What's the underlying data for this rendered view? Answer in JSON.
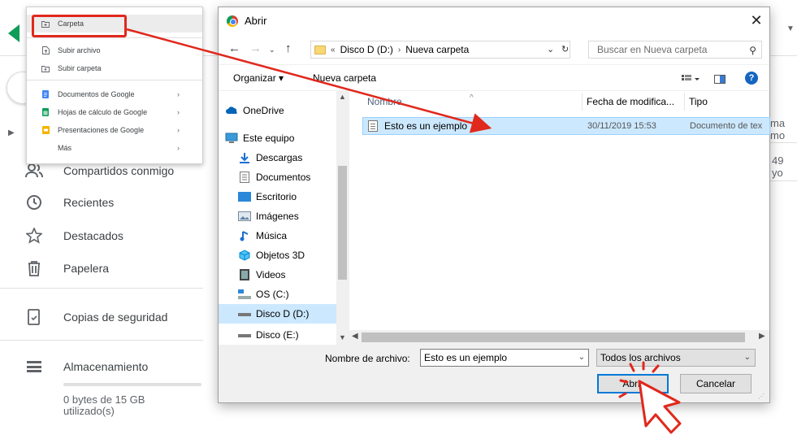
{
  "drive": {
    "nav": {
      "shared": "Compartidos conmigo",
      "recent": "Recientes",
      "starred": "Destacados",
      "trash": "Papelera",
      "backups": "Copias de seguridad",
      "storage": "Almacenamiento"
    },
    "storage_text": "0 bytes de 15 GB utilizado(s)",
    "right_fragment_1": "ma mo",
    "right_fragment_2": "49 yo"
  },
  "new_menu": {
    "items": [
      {
        "label": "Carpeta",
        "icon": "folder-plus-icon"
      },
      {
        "label": "Subir archivo",
        "icon": "file-upload-icon"
      },
      {
        "label": "Subir carpeta",
        "icon": "folder-upload-icon"
      },
      {
        "label": "Documentos de Google",
        "icon": "google-docs-icon",
        "color": "#4285f4"
      },
      {
        "label": "Hojas de cálculo de Google",
        "icon": "google-sheets-icon",
        "color": "#0f9d58"
      },
      {
        "label": "Presentaciones de Google",
        "icon": "google-slides-icon",
        "color": "#f4b400"
      },
      {
        "label": "Más",
        "icon": ""
      }
    ]
  },
  "dialog": {
    "title": "Abrir",
    "close": "✕",
    "address": {
      "prefix": "«",
      "segments": [
        "Disco D (D:)",
        "Nueva carpeta"
      ]
    },
    "search_placeholder": "Buscar en Nueva carpeta",
    "toolbar": {
      "organize": "Organizar ▾",
      "new_folder": "Nueva carpeta"
    },
    "nav_pane": [
      {
        "label": "OneDrive",
        "icon": "onedrive-icon"
      },
      {
        "label": "Este equipo",
        "icon": "computer-icon"
      },
      {
        "label": "Descargas",
        "icon": "downloads-icon"
      },
      {
        "label": "Documentos",
        "icon": "documents-icon"
      },
      {
        "label": "Escritorio",
        "icon": "desktop-icon"
      },
      {
        "label": "Imágenes",
        "icon": "pictures-icon"
      },
      {
        "label": "Música",
        "icon": "music-icon"
      },
      {
        "label": "Objetos 3D",
        "icon": "3d-objects-icon"
      },
      {
        "label": "Videos",
        "icon": "videos-icon"
      },
      {
        "label": "OS (C:)",
        "icon": "drive-c-icon"
      },
      {
        "label": "Disco D (D:)",
        "icon": "drive-icon",
        "selected": true
      },
      {
        "label": "Disco (E:)",
        "icon": "drive-icon"
      }
    ],
    "columns": {
      "name": "Nombre",
      "date": "Fecha de modifica...",
      "type": "Tipo"
    },
    "files": [
      {
        "name": "Esto es un ejemplo",
        "date": "30/11/2019 15:53",
        "type": "Documento de tex"
      }
    ],
    "filename_label": "Nombre de archivo:",
    "filename_value": "Esto es un ejemplo",
    "filter_value": "Todos los archivos",
    "open_button": "Abrir",
    "cancel_button": "Cancelar"
  },
  "annotation_colors": {
    "arrow": "#e0281c",
    "highlight_box": "#e0281c"
  }
}
